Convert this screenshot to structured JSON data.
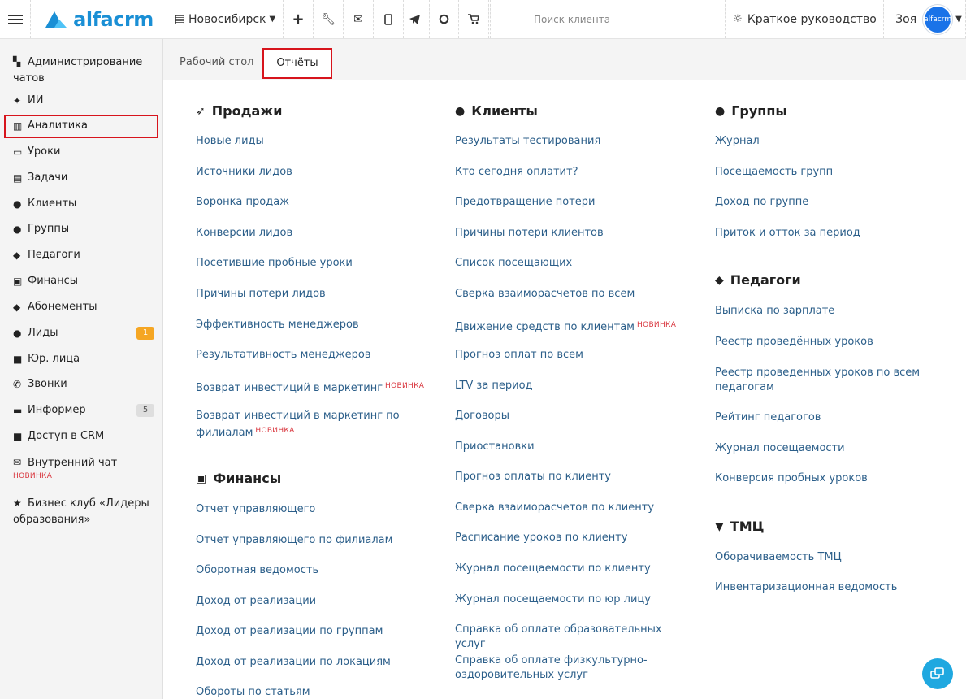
{
  "header": {
    "logo_text": "alfacrm",
    "city": "Новосибирск",
    "search_placeholder": "Поиск клиента",
    "guide_label": "Краткое руководство",
    "user_name": "Зоя",
    "avatar_text": "alfacrm",
    "icons": [
      "plus-icon",
      "wrench-icon",
      "mail-icon",
      "phone-icon",
      "telegram-icon",
      "whatsapp-icon",
      "cart-icon"
    ]
  },
  "sidebar": {
    "items": [
      {
        "label": "Администрирование чатов",
        "icon": "chat-admin-icon"
      },
      {
        "label": "ИИ",
        "icon": "sparkle-icon"
      },
      {
        "label": "Аналитика",
        "icon": "map-icon"
      },
      {
        "label": "Уроки",
        "icon": "calendar-icon"
      },
      {
        "label": "Задачи",
        "icon": "clipboard-icon"
      },
      {
        "label": "Клиенты",
        "icon": "user-icon"
      },
      {
        "label": "Группы",
        "icon": "users-icon"
      },
      {
        "label": "Педагоги",
        "icon": "graduation-cap-icon"
      },
      {
        "label": "Финансы",
        "icon": "money-icon"
      },
      {
        "label": "Абонементы",
        "icon": "tag-icon"
      },
      {
        "label": "Лиды",
        "icon": "user-plus-icon",
        "badge": "1"
      },
      {
        "label": "Юр. лица",
        "icon": "briefcase-icon"
      },
      {
        "label": "Звонки",
        "icon": "phone-call-icon"
      },
      {
        "label": "Информер",
        "icon": "informer-icon",
        "badge": "5"
      },
      {
        "label": "Доступ в CRM",
        "icon": "lock-icon"
      },
      {
        "label": "Внутренний чат",
        "icon": "envelope-icon",
        "new": "НОВИНКА"
      },
      {
        "label": "Бизнес клуб «Лидеры образования»",
        "icon": "star-icon"
      }
    ]
  },
  "tabs": {
    "desktop": "Рабочий стол",
    "reports": "Отчёты"
  },
  "new_tag": "НОВИНКА",
  "sections": {
    "sales": {
      "title": "Продажи",
      "links": [
        "Новые лиды",
        "Источники лидов",
        "Воронка продаж",
        "Конверсии лидов",
        "Посетившие пробные уроки",
        "Причины потери лидов",
        "Эффективность менеджеров",
        "Результативность менеджеров",
        "Возврат инвестиций в маркетинг",
        "Возврат инвестиций в маркетинг по филиалам"
      ]
    },
    "finance": {
      "title": "Финансы",
      "links": [
        "Отчет управляющего",
        "Отчет управляющего по филиалам",
        "Оборотная ведомость",
        "Доход от реализации",
        "Доход от реализации по группам",
        "Доход от реализации по локациям",
        "Обороты по статьям"
      ]
    },
    "clients": {
      "title": "Клиенты",
      "links": [
        "Результаты тестирования",
        "Кто сегодня оплатит?",
        "Предотвращение потери",
        "Причины потери клиентов",
        "Список посещающих",
        "Сверка взаиморасчетов по всем",
        "Движение средств по клиентам",
        "Прогноз оплат по всем",
        "LTV за период",
        "Договоры",
        "Приостановки",
        "Прогноз оплаты по клиенту",
        "Сверка взаиморасчетов по клиенту",
        "Расписание уроков по клиенту",
        "Журнал посещаемости по клиенту",
        "Журнал посещаемости по юр лицу",
        "Справка об оплате образовательных услуг",
        "Справка об оплате физкультурно-оздоровительных услуг"
      ]
    },
    "groups": {
      "title": "Группы",
      "links": [
        "Журнал",
        "Посещаемость групп",
        "Доход по группе",
        "Приток и отток за период"
      ]
    },
    "teachers": {
      "title": "Педагоги",
      "links": [
        "Выписка по зарплате",
        "Реестр проведённых уроков",
        "Реестр проведенных уроков по всем педагогам",
        "Рейтинг педагогов",
        "Журнал посещаемости",
        "Конверсия пробных уроков"
      ]
    },
    "tmc": {
      "title": "ТМЦ",
      "links": [
        "Оборачиваемость ТМЦ",
        "Инвентаризационная ведомость"
      ]
    }
  }
}
